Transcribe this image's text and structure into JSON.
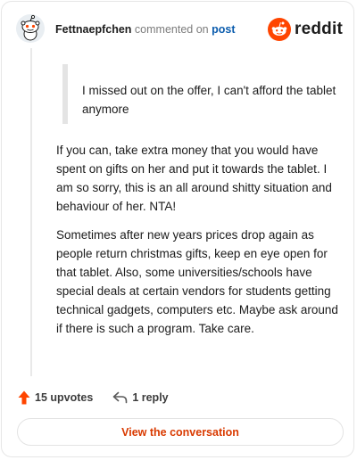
{
  "header": {
    "username": "Fettnaepfchen",
    "action_text": "commented on",
    "post_link": "post",
    "brand": "reddit",
    "avatar_icon": "snoo-avatar-icon",
    "logo_icon": "reddit-alien-icon"
  },
  "quote": {
    "text": "I missed out on the offer, I can't afford the tablet anymore"
  },
  "comment": {
    "paragraphs": [
      "If you can, take extra money that you would have spent on gifts on her and put it towards the tablet. I am so sorry, this is an all around shitty situation and behaviour of her. NTA!",
      "Sometimes after new years prices drop again as people return christmas gifts, keep en eye open for that tablet. Also, some universities/schools have special deals at certain vendors for students getting technical gadgets, computers etc. Maybe ask around if there is such a program. Take care."
    ]
  },
  "actions": {
    "upvotes_label": "15 upvotes",
    "reply_label": "1 reply",
    "upvote_icon": "upvote-arrow-icon",
    "reply_icon": "reply-arrow-icon"
  },
  "cta": {
    "label": "View the conversation"
  },
  "colors": {
    "brand_orange": "#ff4500",
    "cta_text": "#d93a00",
    "link_blue": "#0b5cad"
  }
}
